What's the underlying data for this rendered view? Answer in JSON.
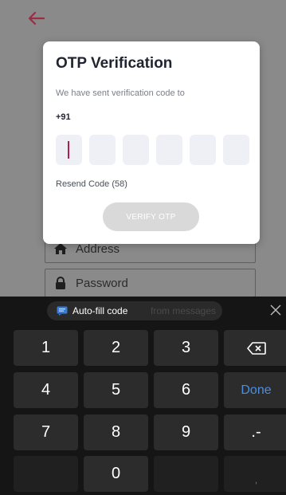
{
  "app": {
    "fields": [
      {
        "label": "Address",
        "icon": "home-icon"
      },
      {
        "label": "Password",
        "icon": "lock-icon"
      }
    ],
    "accent": "#b0204a"
  },
  "dialog": {
    "title": "OTP Verification",
    "subtitle": "We have sent verification code to",
    "phone": "+91",
    "boxes": 6,
    "resend": "Resend Code (58)",
    "verify_label": "VERIFY OTP"
  },
  "keyboard": {
    "autofill_label": "Auto-fill code",
    "autofill_ghost": "from messages",
    "rows": [
      [
        "1",
        "2",
        "3",
        "backspace"
      ],
      [
        "4",
        "5",
        "6",
        "Done"
      ],
      [
        "7",
        "8",
        "9",
        ".-"
      ],
      [
        "",
        "0",
        "",
        ","
      ]
    ],
    "done_label": "Done",
    "dot_dash": ".-",
    "comma": ","
  }
}
